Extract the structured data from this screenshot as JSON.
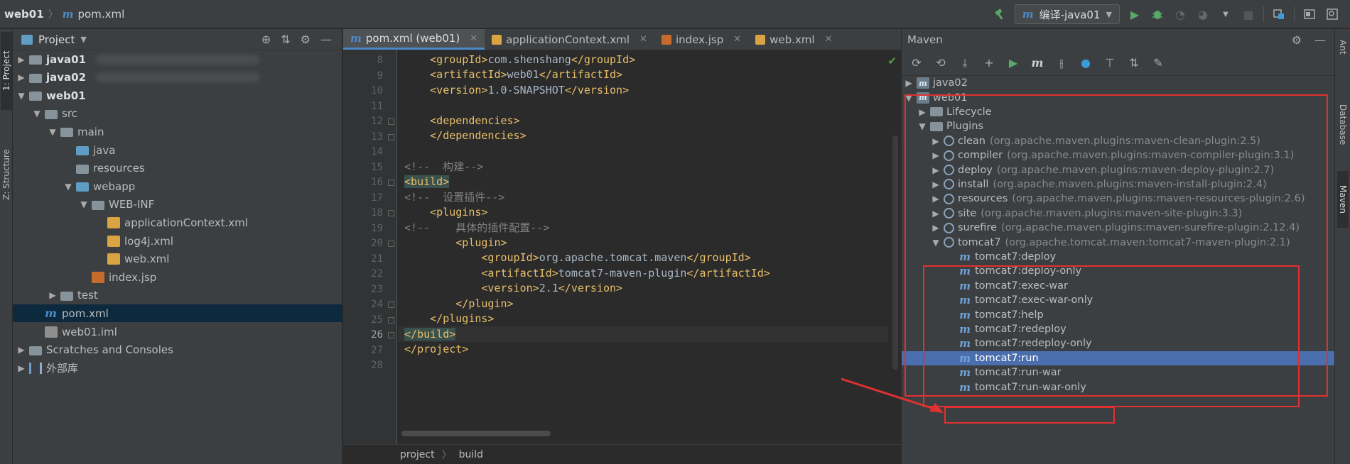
{
  "titlebar": {
    "project": "web01",
    "file": "pom.xml",
    "run_config": "编译-java01",
    "icons": [
      "hammer-icon",
      "play-icon",
      "debug-icon",
      "coverage-icon",
      "profile-icon",
      "stop-icon",
      "project-structure-icon",
      "layout-icon",
      "search-icon"
    ]
  },
  "left_stripe": {
    "tab_project": "1: Project",
    "tab_structure": "Z: Structure"
  },
  "project_panel": {
    "title": "Project",
    "tree": [
      {
        "label": "java01",
        "bold": true,
        "expanded": false,
        "level": 0,
        "icon": "module-folder-icon"
      },
      {
        "label": "java02",
        "bold": true,
        "expanded": false,
        "level": 0,
        "icon": "module-folder-icon"
      },
      {
        "label": "web01",
        "bold": true,
        "expanded": true,
        "level": 0,
        "icon": "module-folder-icon"
      },
      {
        "label": "src",
        "expanded": true,
        "level": 1,
        "icon": "folder-icon"
      },
      {
        "label": "main",
        "expanded": true,
        "level": 2,
        "icon": "folder-icon"
      },
      {
        "label": "java",
        "level": 3,
        "icon": "source-folder-icon"
      },
      {
        "label": "resources",
        "level": 3,
        "icon": "resources-folder-icon"
      },
      {
        "label": "webapp",
        "expanded": true,
        "level": 3,
        "icon": "web-folder-icon"
      },
      {
        "label": "WEB-INF",
        "expanded": true,
        "level": 4,
        "icon": "folder-icon"
      },
      {
        "label": "applicationContext.xml",
        "level": 5,
        "icon": "spring-xml-icon"
      },
      {
        "label": "log4j.xml",
        "level": 5,
        "icon": "xml-file-icon"
      },
      {
        "label": "web.xml",
        "level": 5,
        "icon": "xml-file-icon"
      },
      {
        "label": "index.jsp",
        "level": 4,
        "icon": "jsp-file-icon"
      },
      {
        "label": "test",
        "expanded": false,
        "level": 2,
        "icon": "folder-icon"
      },
      {
        "label": "pom.xml",
        "level": 1,
        "icon": "maven-file-icon",
        "selected": true
      },
      {
        "label": "web01.iml",
        "level": 1,
        "icon": "iml-file-icon"
      },
      {
        "label": "Scratches and Consoles",
        "expanded": false,
        "level": 0,
        "icon": "scratches-icon"
      },
      {
        "label": "外部库",
        "expanded": false,
        "level": 0,
        "icon": "library-icon"
      }
    ]
  },
  "editor": {
    "tabs": [
      {
        "label": "pom.xml (web01)",
        "active": true,
        "icon": "maven-file-icon"
      },
      {
        "label": "applicationContext.xml",
        "icon": "spring-xml-icon"
      },
      {
        "label": "index.jsp",
        "icon": "jsp-file-icon"
      },
      {
        "label": "web.xml",
        "icon": "xml-file-icon"
      }
    ],
    "lines": [
      {
        "n": "8",
        "indent": "    ",
        "parts": [
          [
            "tag",
            "<groupId>"
          ],
          [
            "txt",
            "com.shenshang"
          ],
          [
            "tag",
            "</groupId>"
          ]
        ]
      },
      {
        "n": "9",
        "indent": "    ",
        "parts": [
          [
            "tag",
            "<artifactId>"
          ],
          [
            "txt",
            "web01"
          ],
          [
            "tag",
            "</artifactId>"
          ]
        ]
      },
      {
        "n": "10",
        "indent": "    ",
        "parts": [
          [
            "tag",
            "<version>"
          ],
          [
            "txt",
            "1.0-SNAPSHOT"
          ],
          [
            "tag",
            "</version>"
          ]
        ]
      },
      {
        "n": "11",
        "indent": "",
        "parts": []
      },
      {
        "n": "12",
        "indent": "    ",
        "parts": [
          [
            "tag",
            "<dependencies>"
          ]
        ],
        "fold": true
      },
      {
        "n": "13",
        "indent": "    ",
        "parts": [
          [
            "tag",
            "</dependencies>"
          ]
        ],
        "fold": true
      },
      {
        "n": "14",
        "indent": "",
        "parts": []
      },
      {
        "n": "15",
        "indent": "",
        "parts": [
          [
            "cmt",
            "<!--  构建-->"
          ]
        ]
      },
      {
        "n": "16",
        "indent": "",
        "parts": [
          [
            "taghl",
            "<build>"
          ]
        ],
        "fold": true
      },
      {
        "n": "17",
        "indent": "",
        "parts": [
          [
            "cmt",
            "<!--  设置插件-->"
          ]
        ]
      },
      {
        "n": "18",
        "indent": "    ",
        "parts": [
          [
            "tag",
            "<plugins>"
          ]
        ],
        "fold": true
      },
      {
        "n": "19",
        "indent": "",
        "parts": [
          [
            "cmt",
            "<!--    具体的插件配置-->"
          ]
        ]
      },
      {
        "n": "20",
        "indent": "        ",
        "parts": [
          [
            "tag",
            "<plugin>"
          ]
        ],
        "fold": true
      },
      {
        "n": "21",
        "indent": "            ",
        "parts": [
          [
            "tag",
            "<groupId>"
          ],
          [
            "txt",
            "org.apache.tomcat.maven"
          ],
          [
            "tag",
            "</groupId>"
          ]
        ]
      },
      {
        "n": "22",
        "indent": "            ",
        "parts": [
          [
            "tag",
            "<artifactId>"
          ],
          [
            "txt",
            "tomcat7-maven-plugin"
          ],
          [
            "tag",
            "</artifactId>"
          ]
        ]
      },
      {
        "n": "23",
        "indent": "            ",
        "parts": [
          [
            "tag",
            "<version>"
          ],
          [
            "txt",
            "2.1"
          ],
          [
            "tag",
            "</version>"
          ]
        ]
      },
      {
        "n": "24",
        "indent": "        ",
        "parts": [
          [
            "tag",
            "</plugin>"
          ]
        ],
        "fold": true
      },
      {
        "n": "25",
        "indent": "    ",
        "parts": [
          [
            "tag",
            "</plugins>"
          ]
        ],
        "fold": true
      },
      {
        "n": "26",
        "indent": "",
        "parts": [
          [
            "taghl",
            "</build>"
          ]
        ],
        "fold": true,
        "current": true
      },
      {
        "n": "27",
        "indent": "",
        "parts": [
          [
            "tag",
            "</project>"
          ]
        ]
      },
      {
        "n": "28",
        "indent": "",
        "parts": []
      }
    ],
    "breadcrumb": [
      "project",
      "build"
    ]
  },
  "maven_panel": {
    "title": "Maven",
    "toolbar_icons": [
      "reload-icon",
      "generate-sources-icon",
      "download-icon",
      "add-icon",
      "run-icon",
      "execute-goal-icon",
      "toggle-offline-icon",
      "skip-tests-icon",
      "show-dependencies-icon",
      "collapse-all-icon",
      "settings-wrench-icon"
    ],
    "tree": [
      {
        "label": "java02",
        "level": 0,
        "expanded": false,
        "icon": "project"
      },
      {
        "label": "web01",
        "level": 0,
        "expanded": true,
        "icon": "project"
      },
      {
        "label": "Lifecycle",
        "level": 1,
        "expanded": false,
        "icon": "folder"
      },
      {
        "label": "Plugins",
        "level": 1,
        "expanded": true,
        "icon": "folder"
      },
      {
        "label": "clean",
        "coord": "(org.apache.maven.plugins:maven-clean-plugin:2.5)",
        "level": 2,
        "expanded": false,
        "icon": "gear"
      },
      {
        "label": "compiler",
        "coord": "(org.apache.maven.plugins:maven-compiler-plugin:3.1)",
        "level": 2,
        "expanded": false,
        "icon": "gear"
      },
      {
        "label": "deploy",
        "coord": "(org.apache.maven.plugins:maven-deploy-plugin:2.7)",
        "level": 2,
        "expanded": false,
        "icon": "gear"
      },
      {
        "label": "install",
        "coord": "(org.apache.maven.plugins:maven-install-plugin:2.4)",
        "level": 2,
        "expanded": false,
        "icon": "gear"
      },
      {
        "label": "resources",
        "coord": "(org.apache.maven.plugins:maven-resources-plugin:2.6)",
        "level": 2,
        "expanded": false,
        "icon": "gear"
      },
      {
        "label": "site",
        "coord": "(org.apache.maven.plugins:maven-site-plugin:3.3)",
        "level": 2,
        "expanded": false,
        "icon": "gear"
      },
      {
        "label": "surefire",
        "coord": "(org.apache.maven.plugins:maven-surefire-plugin:2.12.4)",
        "level": 2,
        "expanded": false,
        "icon": "gear"
      },
      {
        "label": "tomcat7",
        "coord": "(org.apache.tomcat.maven:tomcat7-maven-plugin:2.1)",
        "level": 2,
        "expanded": true,
        "icon": "gear"
      },
      {
        "label": "tomcat7:deploy",
        "level": 3,
        "icon": "goal"
      },
      {
        "label": "tomcat7:deploy-only",
        "level": 3,
        "icon": "goal"
      },
      {
        "label": "tomcat7:exec-war",
        "level": 3,
        "icon": "goal"
      },
      {
        "label": "tomcat7:exec-war-only",
        "level": 3,
        "icon": "goal"
      },
      {
        "label": "tomcat7:help",
        "level": 3,
        "icon": "goal"
      },
      {
        "label": "tomcat7:redeploy",
        "level": 3,
        "icon": "goal"
      },
      {
        "label": "tomcat7:redeploy-only",
        "level": 3,
        "icon": "goal"
      },
      {
        "label": "tomcat7:run",
        "level": 3,
        "icon": "goal",
        "selected": true
      },
      {
        "label": "tomcat7:run-war",
        "level": 3,
        "icon": "goal"
      },
      {
        "label": "tomcat7:run-war-only",
        "level": 3,
        "icon": "goal"
      }
    ]
  },
  "right_stripe": {
    "tab_ant": "Ant",
    "tab_database": "Database",
    "tab_maven": "Maven"
  },
  "colors": {
    "annotation": "#e03131",
    "selection": "#4b6eaf",
    "tag": "#e8bf6a",
    "comment": "#808080"
  }
}
